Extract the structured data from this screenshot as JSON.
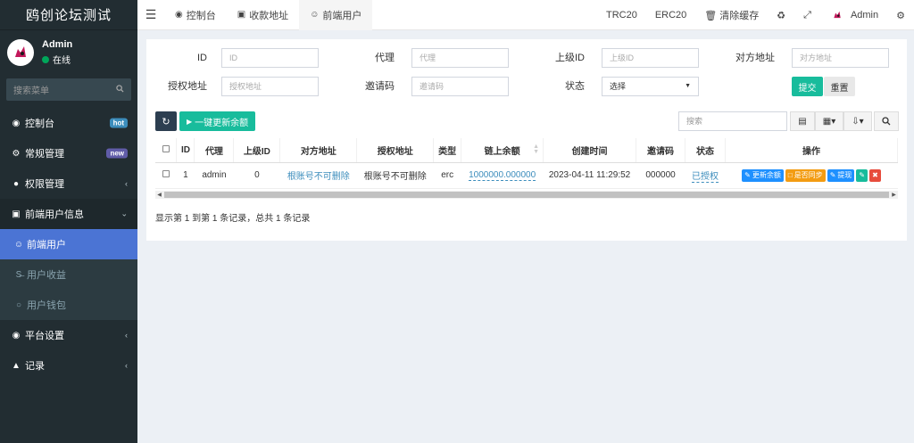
{
  "sidebar": {
    "brand": "鸥创论坛测试",
    "user": {
      "name": "Admin",
      "status": "在线"
    },
    "search_placeholder": "搜索菜单",
    "menu": [
      {
        "label": "控制台",
        "icon": "dashboard-icon",
        "badge": "hot"
      },
      {
        "label": "常规管理",
        "icon": "cogs-icon",
        "badge": "new"
      },
      {
        "label": "权限管理",
        "icon": "users-icon"
      },
      {
        "label": "前端用户信息",
        "icon": "user-card-icon",
        "open": true,
        "children": [
          {
            "label": "前端用户",
            "icon": "user-circle-icon",
            "active": true
          },
          {
            "label": "用户收益",
            "icon": "strikethrough-icon"
          },
          {
            "label": "用户钱包",
            "icon": "circle-icon"
          }
        ]
      },
      {
        "label": "平台设置",
        "icon": "dot-circle-icon"
      },
      {
        "label": "记录",
        "icon": "area-chart-icon"
      }
    ]
  },
  "topbar": {
    "tabs": [
      {
        "label": "控制台",
        "icon": "dashboard-icon"
      },
      {
        "label": "收款地址",
        "icon": "id-card-icon"
      },
      {
        "label": "前端用户",
        "icon": "user-circle-icon",
        "active": true
      }
    ],
    "right": {
      "trc20": "TRC20",
      "erc20": "ERC20",
      "clear_cache": "清除缓存",
      "admin": "Admin"
    }
  },
  "filters": {
    "id_label": "ID",
    "id_placeholder": "ID",
    "agent_label": "代理",
    "agent_placeholder": "代理",
    "parent_label": "上级ID",
    "parent_placeholder": "上级ID",
    "target_label": "对方地址",
    "target_placeholder": "对方地址",
    "auth_label": "授权地址",
    "auth_placeholder": "授权地址",
    "invite_label": "邀请码",
    "invite_placeholder": "邀请码",
    "status_label": "状态",
    "status_value": "选择",
    "submit": "提交",
    "reset": "重置"
  },
  "toolbar": {
    "update_all": "一键更新余额",
    "search_placeholder": "搜索"
  },
  "table": {
    "headers": [
      "ID",
      "代理",
      "上级ID",
      "对方地址",
      "授权地址",
      "类型",
      "链上余额",
      "创建时间",
      "邀请码",
      "状态",
      "操作"
    ],
    "rows": [
      {
        "id": "1",
        "agent": "admin",
        "parent": "0",
        "target": "根账号不可删除",
        "auth": "根账号不可删除",
        "type": "erc",
        "balance": "1000000.000000",
        "created": "2023-04-11 11:29:52",
        "invite": "000000",
        "status": "已授权"
      }
    ],
    "ops": {
      "update": "更新余额",
      "sync": "是否同步",
      "withdraw": "提现"
    }
  },
  "pagination": {
    "info": "显示第 1 到第 1 条记录，总共 1 条记录"
  },
  "colors": {
    "sidebar": "#222d32",
    "active": "#4b74d4",
    "primary": "#18bc9c",
    "link": "#3c8dbc"
  }
}
